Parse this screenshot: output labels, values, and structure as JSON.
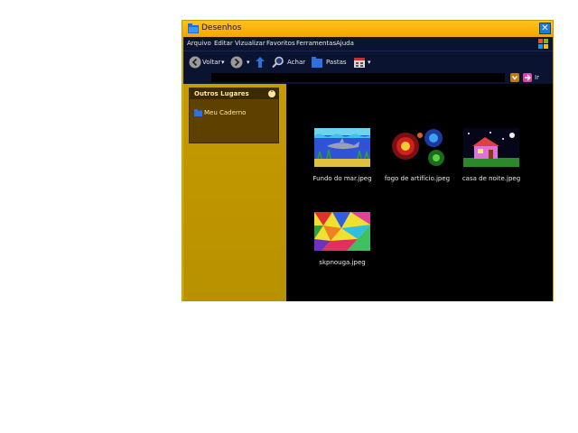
{
  "window": {
    "title": "Desenhos",
    "close_glyph": "✕"
  },
  "menu": [
    "Arquivo",
    "Editar",
    "Vizualizar",
    "Favoritos",
    "Ferramentas",
    "Ajuda"
  ],
  "toolbar": {
    "back_label": "Voltar",
    "search_label": "Achar",
    "folders_label": "Pastas"
  },
  "address": {
    "go_label": "Ir"
  },
  "sidebar": {
    "panel_title": "Outros Lugares",
    "places": [
      "Meu Caderno"
    ]
  },
  "files": [
    {
      "name": "Fundo do mar.jpeg",
      "icon": "underwater-shark-thumbnail"
    },
    {
      "name": "fogo de artifício.jpeg",
      "icon": "fireworks-thumbnail"
    },
    {
      "name": "casa de noite.jpeg",
      "icon": "house-at-night-thumbnail"
    },
    {
      "name": "skpnouga.jpeg",
      "icon": "colorful-shards-thumbnail"
    }
  ],
  "colors": {
    "titlebar": "#f3a600",
    "sidebar": "#c69a00",
    "content_bg": "#000000",
    "menubar_bg": "#0a1430"
  }
}
